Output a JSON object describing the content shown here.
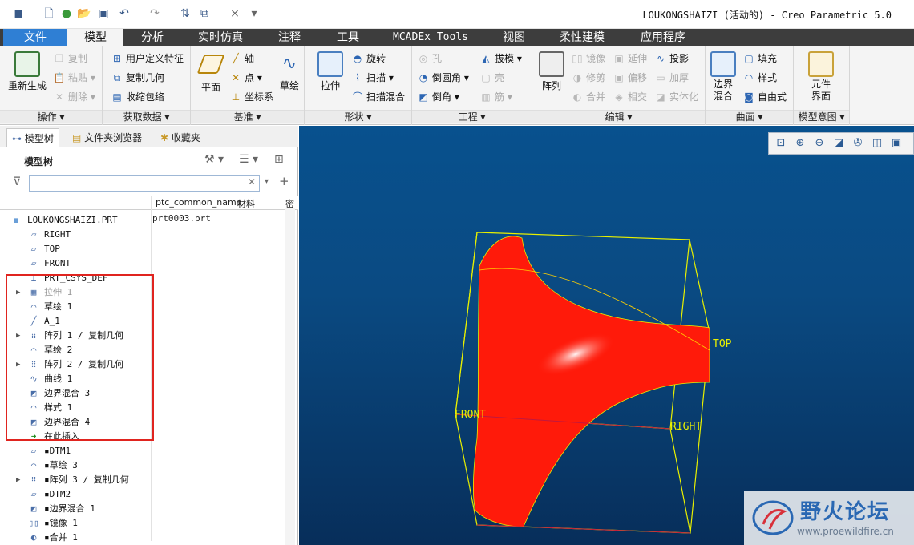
{
  "window": {
    "title": "LOUKONGSHAIZI (活动的) - Creo Parametric 5.0"
  },
  "quick_access": [
    "new-icon",
    "open-icon",
    "save-icon",
    "undo-icon",
    "redo-icon",
    "regenerate-icon",
    "windows-icon",
    "close-icon",
    "more-icon"
  ],
  "tabs": [
    "文件",
    "模型",
    "分析",
    "实时仿真",
    "注释",
    "工具",
    "MCADEx Tools",
    "视图",
    "柔性建模",
    "应用程序"
  ],
  "ribbon": {
    "groups": {
      "operations": {
        "label": "操作 ▾",
        "big": "重新生成",
        "items": [
          "复制",
          "粘贴 ▾",
          "删除 ▾"
        ]
      },
      "get_data": {
        "label": "获取数据 ▾",
        "items": [
          "用户定义特征",
          "复制几何",
          "收缩包络"
        ]
      },
      "datum": {
        "label": "基准 ▾",
        "big1": "平面",
        "items": [
          "轴",
          "点 ▾",
          "坐标系"
        ],
        "big2": "草绘"
      },
      "shapes": {
        "label": "形状 ▾",
        "big": "拉伸",
        "items": [
          "旋转",
          "扫描 ▾",
          "扫描混合"
        ]
      },
      "engineering": {
        "label": "工程 ▾",
        "items": [
          "孔",
          "倒圆角 ▾",
          "倒角 ▾",
          "拔模 ▾",
          "壳",
          "筋 ▾"
        ]
      },
      "editing": {
        "label": "编辑 ▾",
        "big": "阵列",
        "items": [
          "镜像",
          "修剪",
          "合并",
          "延伸",
          "偏移",
          "相交",
          "投影",
          "加厚",
          "实体化"
        ]
      },
      "surfaces": {
        "label": "曲面 ▾",
        "big": "边界\n混合",
        "items": [
          "填充",
          "样式",
          "自由式"
        ]
      },
      "design_intent": {
        "label": "模型意图 ▾",
        "big": "元件\n界面"
      }
    }
  },
  "nav_tabs": [
    "模型树",
    "文件夹浏览器",
    "收藏夹"
  ],
  "model_tree": {
    "title": "模型树",
    "filter_placeholder": "",
    "columns": [
      "ptc_common_name",
      "材料",
      "密"
    ],
    "root": {
      "label": "LOUKONGSHAIZI.PRT",
      "common_name": "prt0003.prt"
    },
    "items": [
      {
        "label": "RIGHT",
        "icon": "datum-plane-icon",
        "expand": ""
      },
      {
        "label": "TOP",
        "icon": "datum-plane-icon",
        "expand": ""
      },
      {
        "label": "FRONT",
        "icon": "datum-plane-icon",
        "expand": ""
      },
      {
        "label": "PRT_CSYS_DEF",
        "icon": "csys-icon",
        "expand": ""
      },
      {
        "label": "拉伸 1",
        "icon": "extrude-icon",
        "expand": "▶",
        "dim": true
      },
      {
        "label": "草绘 1",
        "icon": "sketch-icon",
        "expand": ""
      },
      {
        "label": "A_1",
        "icon": "axis-icon",
        "expand": ""
      },
      {
        "label": "阵列 1 / 复制几何",
        "icon": "pattern-icon",
        "expand": "▶"
      },
      {
        "label": "草绘 2",
        "icon": "sketch-icon",
        "expand": ""
      },
      {
        "label": "阵列 2 / 复制几何",
        "icon": "pattern-icon",
        "expand": "▶"
      },
      {
        "label": "曲线 1",
        "icon": "curve-icon",
        "expand": ""
      },
      {
        "label": "边界混合 3",
        "icon": "boundary-blend-icon",
        "expand": ""
      },
      {
        "label": "样式 1",
        "icon": "style-icon",
        "expand": ""
      },
      {
        "label": "边界混合 4",
        "icon": "boundary-blend-icon",
        "expand": ""
      },
      {
        "label": "在此插入",
        "icon": "insert-here-icon",
        "expand": ""
      },
      {
        "label": "▪DTM1",
        "icon": "datum-plane-icon",
        "expand": ""
      },
      {
        "label": "▪草绘 3",
        "icon": "sketch-icon",
        "expand": ""
      },
      {
        "label": "▪阵列 3 / 复制几何",
        "icon": "pattern-icon",
        "expand": "▶"
      },
      {
        "label": "▪DTM2",
        "icon": "datum-plane-icon",
        "expand": ""
      },
      {
        "label": "▪边界混合 1",
        "icon": "boundary-blend-icon",
        "expand": ""
      },
      {
        "label": "▪镜像 1",
        "icon": "mirror-icon",
        "expand": ""
      },
      {
        "label": "▪合并 1",
        "icon": "merge-icon",
        "expand": ""
      }
    ]
  },
  "viewport": {
    "datum_labels": {
      "top": "TOP",
      "front": "FRONT",
      "right": "RIGHT"
    },
    "colors": {
      "surface": "#ff1a0a",
      "datum": "#e8f000",
      "background": "#0a4a82"
    },
    "watermark": {
      "title": "野火论坛",
      "url": "www.proewildfire.cn"
    }
  }
}
